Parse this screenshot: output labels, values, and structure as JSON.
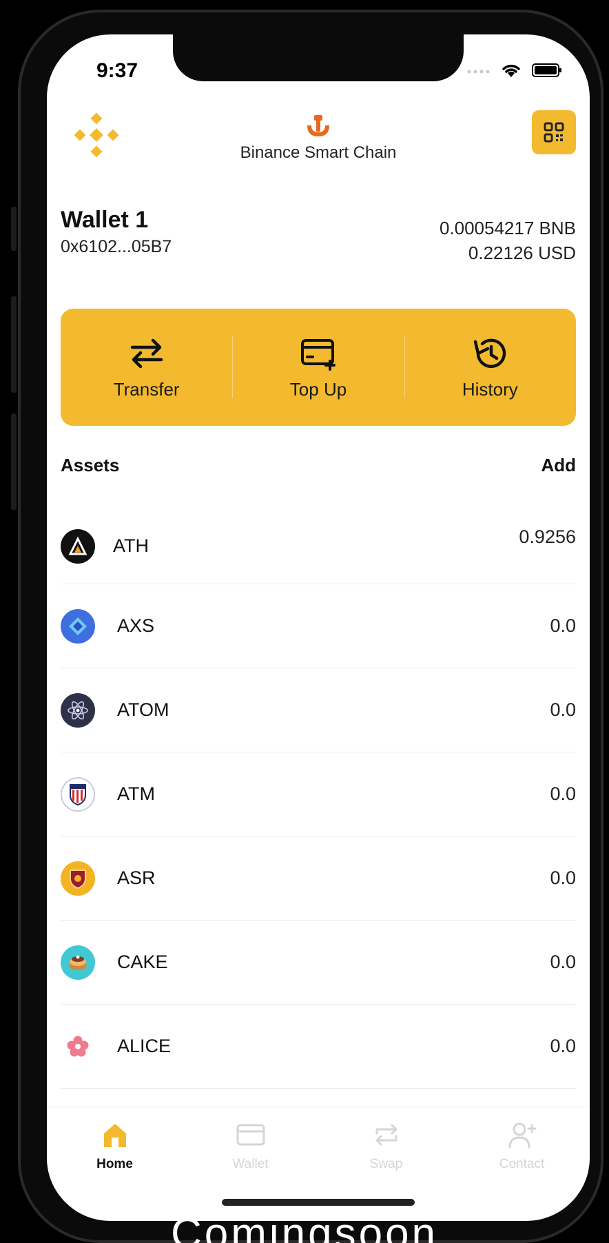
{
  "status": {
    "time": "9:37"
  },
  "header": {
    "network": "Binance Smart Chain"
  },
  "wallet": {
    "name": "Wallet 1",
    "address": "0x6102...05B7",
    "balance_bnb": "0.00054217 BNB",
    "balance_usd": "0.22126 USD"
  },
  "actions": [
    {
      "label": "Transfer"
    },
    {
      "label": "Top Up"
    },
    {
      "label": "History"
    }
  ],
  "assets": {
    "title": "Assets",
    "add_label": "Add",
    "items": [
      {
        "symbol": "ATH",
        "amount": "0.9256"
      },
      {
        "symbol": "AXS",
        "amount": "0.0"
      },
      {
        "symbol": "ATOM",
        "amount": "0.0"
      },
      {
        "symbol": "ATM",
        "amount": "0.0"
      },
      {
        "symbol": "ASR",
        "amount": "0.0"
      },
      {
        "symbol": "CAKE",
        "amount": "0.0"
      },
      {
        "symbol": "ALICE",
        "amount": "0.0"
      }
    ]
  },
  "tabs": [
    {
      "label": "Home",
      "icon": "home-icon",
      "active": true
    },
    {
      "label": "Wallet",
      "icon": "card-icon",
      "active": false
    },
    {
      "label": "Swap",
      "icon": "swap-icon",
      "active": false
    },
    {
      "label": "Contact",
      "icon": "add-contact-icon",
      "active": false
    }
  ],
  "caption": "Comingsoon",
  "colors": {
    "accent": "#F3BA2F",
    "network_icon": "#E8691D"
  }
}
